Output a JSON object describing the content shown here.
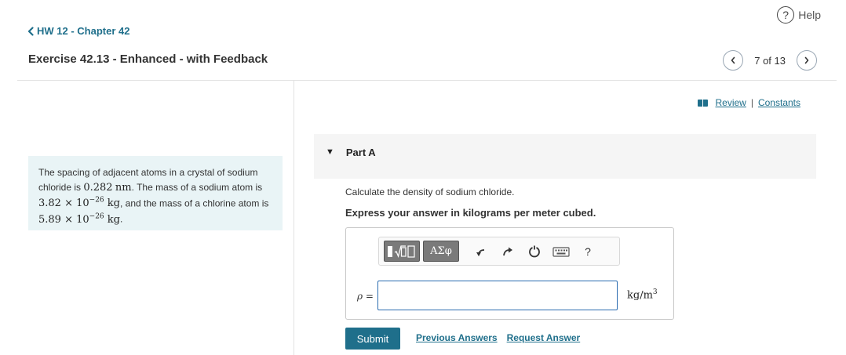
{
  "header": {
    "help_label": "Help",
    "help_icon": "?",
    "breadcrumb": "HW 12 - Chapter 42",
    "title": "Exercise 42.13 - Enhanced - with Feedback",
    "pager": {
      "text": "7 of 13"
    }
  },
  "links": {
    "review": "Review",
    "constants": "Constants",
    "separator": "|"
  },
  "problem": {
    "p1": "The spacing of adjacent atoms in a crystal of sodium chloride is ",
    "spacing_value": "0.282",
    "spacing_unit": "nm",
    "p2": ". The mass of a sodium atom is ",
    "na_mass_mantissa": "3.82 × 10",
    "na_mass_exp": "−26",
    "na_mass_unit": "kg",
    "p3": ", and the mass of a chlorine atom is ",
    "cl_mass_mantissa": "5.89 × 10",
    "cl_mass_exp": "−26",
    "cl_mass_unit": "kg",
    "p4": "."
  },
  "part": {
    "label": "Part A",
    "question": "Calculate the density of sodium chloride.",
    "instruction": "Express your answer in kilograms per meter cubed."
  },
  "toolbar": {
    "greek_label": "ΑΣφ",
    "help_label": "?"
  },
  "answer": {
    "variable_label": "ρ =",
    "value": "",
    "units_base": "kg/m",
    "units_exp": "3"
  },
  "actions": {
    "submit": "Submit",
    "previous_answers": "Previous Answers",
    "request_answer": "Request Answer"
  },
  "colors": {
    "accent": "#1f6f8b",
    "problem_bg": "#e9f4f6",
    "input_border": "#2b6cb0"
  }
}
